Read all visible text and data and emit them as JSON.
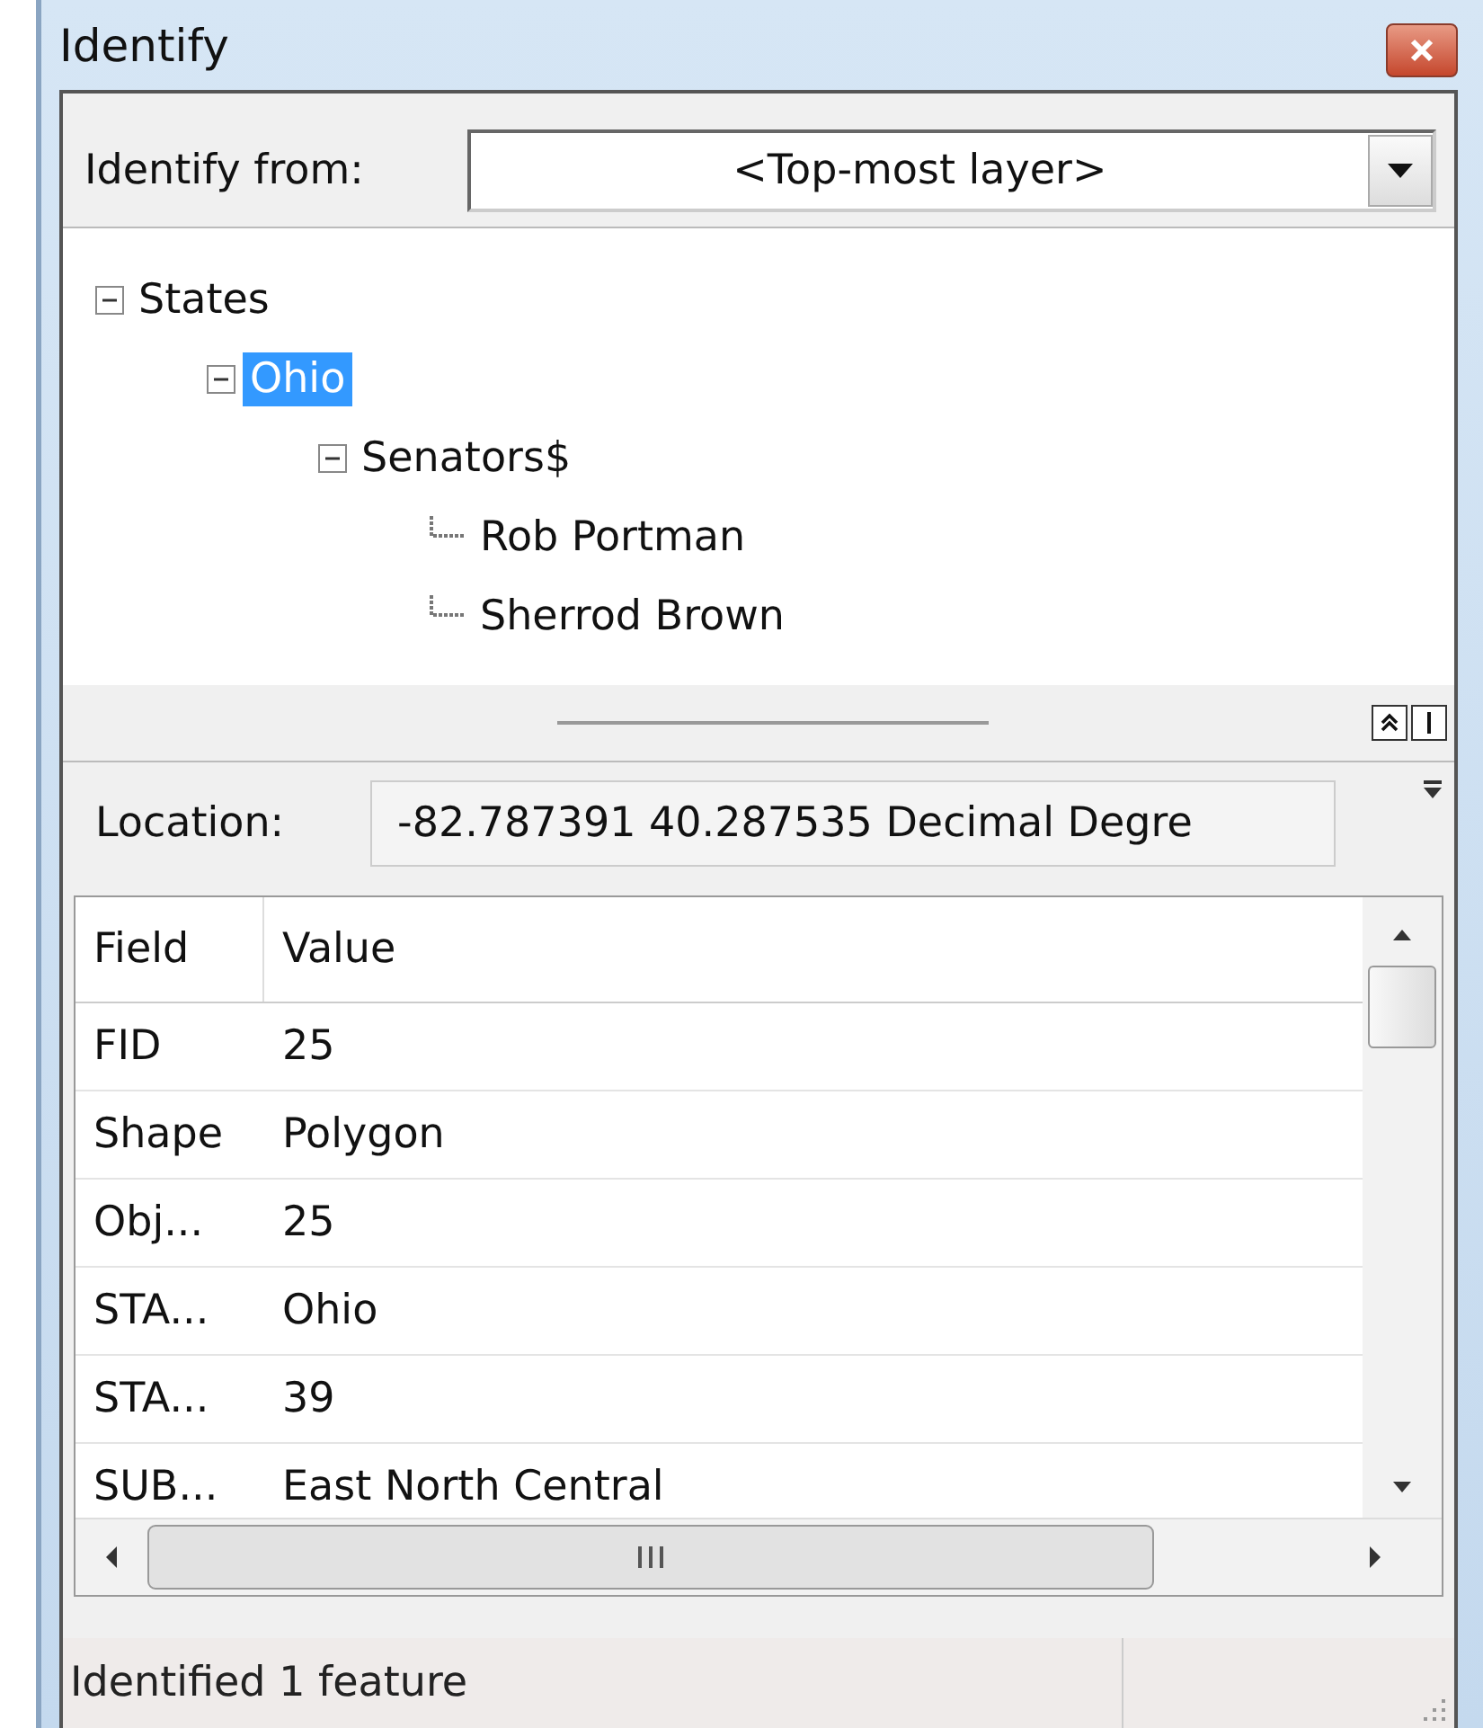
{
  "window": {
    "title": "Identify"
  },
  "identify_from": {
    "label": "Identify from:",
    "value": "<Top-most layer>"
  },
  "tree": [
    {
      "label": "States",
      "expanded": true,
      "selected": false,
      "children": [
        {
          "label": "Ohio",
          "expanded": true,
          "selected": true,
          "children": [
            {
              "label": "Senators$",
              "expanded": true,
              "selected": false,
              "children": [
                {
                  "label": "Rob Portman",
                  "selected": false
                },
                {
                  "label": "Sherrod Brown",
                  "selected": false
                }
              ]
            }
          ]
        }
      ]
    }
  ],
  "location": {
    "label": "Location:",
    "value": "-82.787391  40.287535 Decimal Degre"
  },
  "table": {
    "columns": [
      "Field",
      "Value"
    ],
    "rows": [
      [
        "FID",
        "25"
      ],
      [
        "Shape",
        "Polygon"
      ],
      [
        "Obj...",
        "25"
      ],
      [
        "STA...",
        "Ohio"
      ],
      [
        "STA...",
        "39"
      ],
      [
        "SUB...",
        "East North Central"
      ]
    ]
  },
  "status_bar": "Identified 1 feature"
}
